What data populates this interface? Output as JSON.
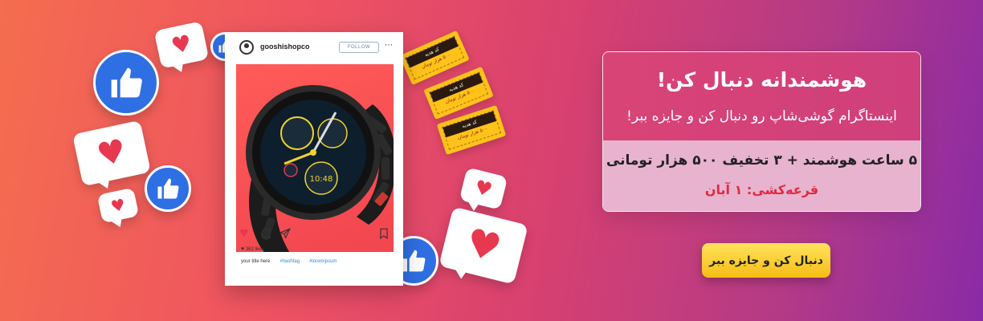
{
  "post": {
    "username": "gooshishopco",
    "follow_label": "FOLLOW",
    "more_icon": "⋯",
    "likes": "362 likes",
    "caption": "your title here",
    "hashtags": [
      "#hashtag",
      "#loremipsum"
    ],
    "icons": [
      "heart-icon",
      "comment-icon",
      "share-icon",
      "bookmark-icon"
    ]
  },
  "tickets": [
    {
      "top": "کد هدیه",
      "bottom": "۵۰۰ هزار تومان"
    },
    {
      "top": "کد هدیه",
      "bottom": "۵۰۰ هزار تومان"
    },
    {
      "top": "کد هدیه",
      "bottom": "۵۰۰ هزار تومان"
    }
  ],
  "info": {
    "title": "هوشمندانه دنبال کن!",
    "subtitle": "اینستاگرام گوشی‌شاپ رو دنبال کن و جایزه ببر!",
    "offer": "۵ ساعت هوشمند + ۳ تخفیف ۵۰۰ هزار تومانی",
    "draw_date": "قرعه‌کشی: ۱ آبان"
  },
  "cta": {
    "label": "دنبال کن و جایزه ببر"
  },
  "colors": {
    "accent_red": "#e02a3e",
    "cta_yellow": "#f6bd14",
    "like_blue": "#2f6fe4",
    "heart_red": "#e8384f"
  }
}
